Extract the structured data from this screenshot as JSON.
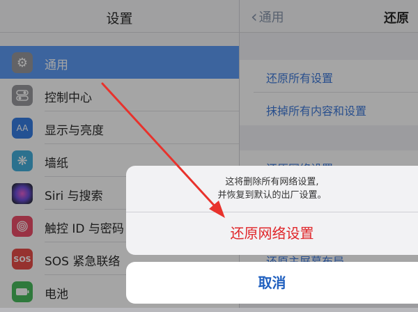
{
  "left": {
    "title": "设置",
    "items": [
      {
        "label": "通用",
        "icon": "gear-icon",
        "color": "#8e8e93",
        "glyph": "⚙",
        "selected": true
      },
      {
        "label": "控制中心",
        "icon": "control-center-icon",
        "color": "#8e8e93",
        "glyph": "☰"
      },
      {
        "label": "显示与亮度",
        "icon": "display-brightness-icon",
        "color": "#1f6fe0",
        "glyph": "AA"
      },
      {
        "label": "墙纸",
        "icon": "wallpaper-icon",
        "color": "#2fa5d8",
        "glyph": "❋"
      },
      {
        "label": "Siri 与搜索",
        "icon": "siri-icon",
        "color": "#3b2c6e",
        "glyph": "◉"
      },
      {
        "label": "触控 ID 与密码",
        "icon": "fingerprint-icon",
        "color": "#ea3a58",
        "glyph": "◎"
      },
      {
        "label": "SOS 紧急联络",
        "icon": "sos-icon",
        "color": "#e53935",
        "glyph": "SOS"
      },
      {
        "label": "电池",
        "icon": "battery-icon",
        "color": "#34b44a",
        "glyph": "▭"
      }
    ]
  },
  "right": {
    "back_label": "通用",
    "title": "还原",
    "group1": [
      "还原所有设置",
      "抹掉所有内容和设置"
    ],
    "group2": [
      "还原网络设置",
      "还原主屏幕布局"
    ]
  },
  "sheet": {
    "message_line1": "这将删除所有网络设置,",
    "message_line2": "并恢复到默认的出厂设置。",
    "action_label": "还原网络设置",
    "cancel_label": "取消"
  },
  "colors": {
    "selected": "#4a8ff3",
    "destructive": "#e0262a",
    "link": "#2a6cd6",
    "arrow": "#e8322c"
  }
}
